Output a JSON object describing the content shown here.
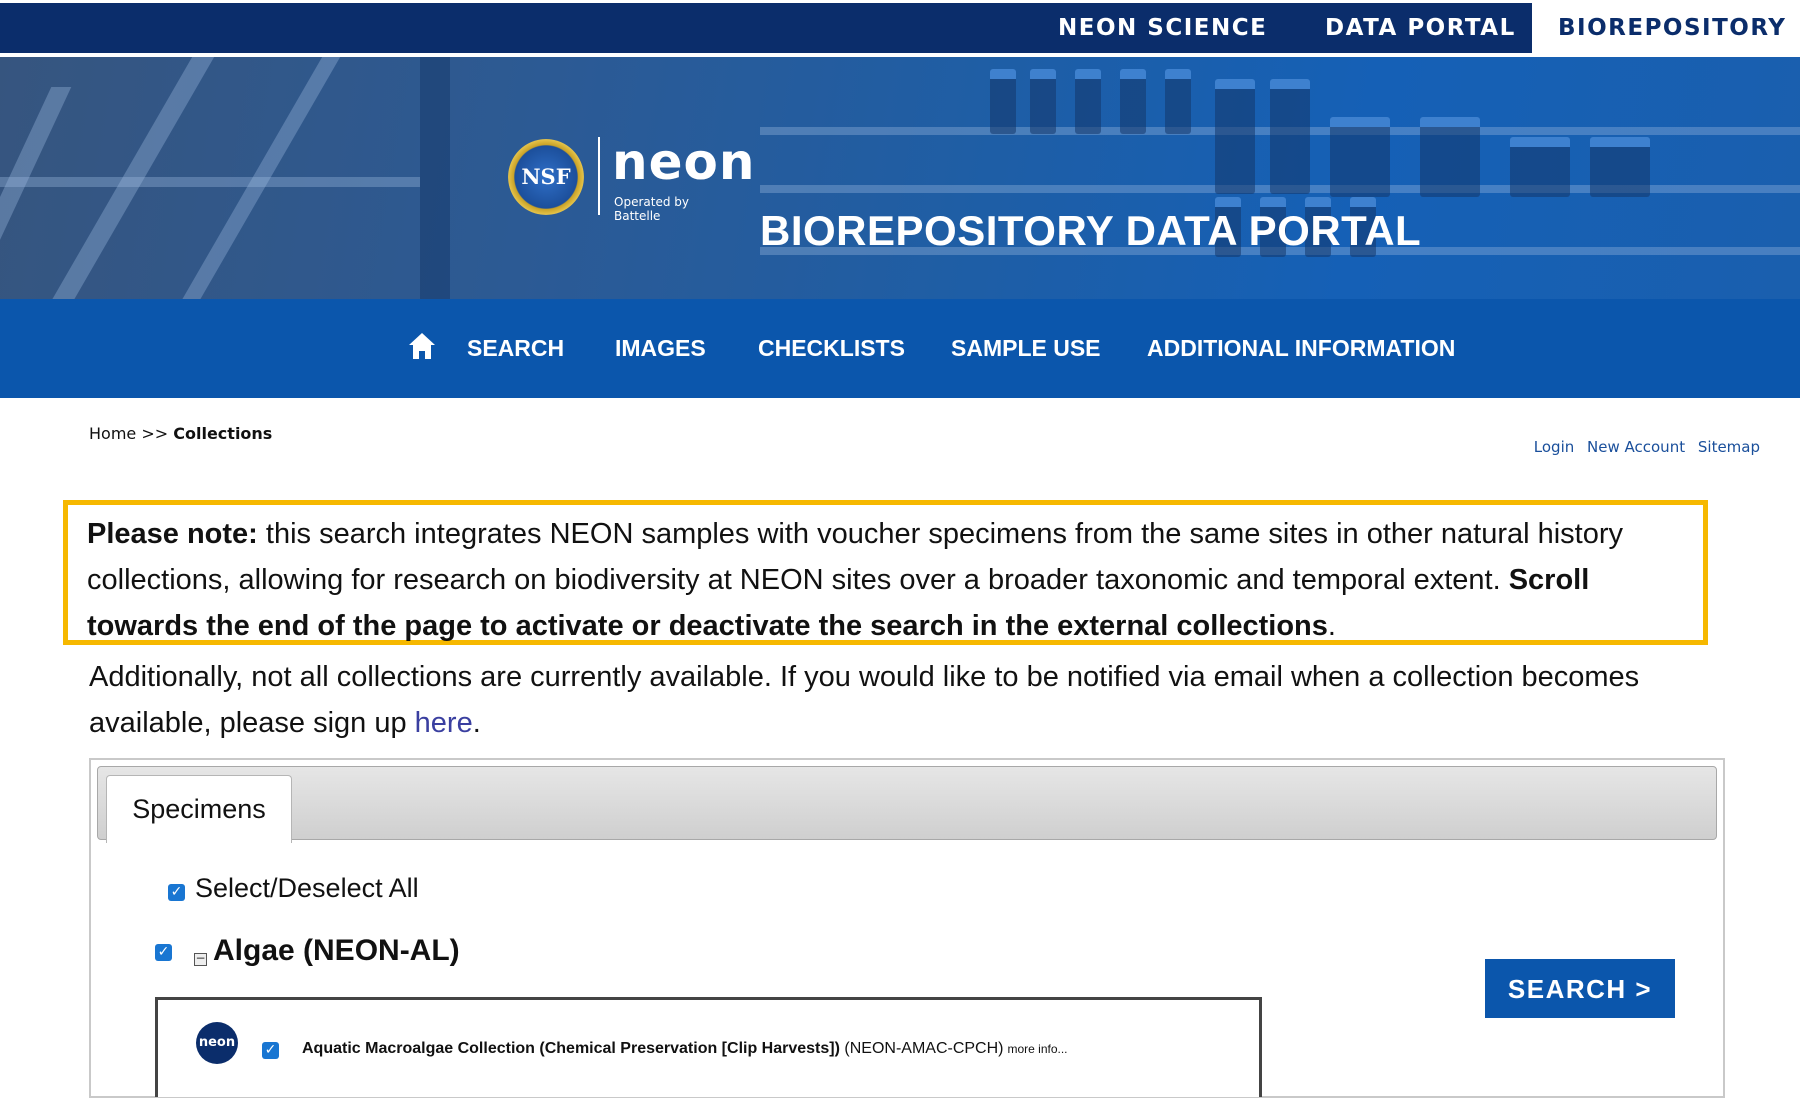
{
  "topbar": {
    "links": [
      {
        "label": "NEON SCIENCE"
      },
      {
        "label": "DATA PORTAL"
      },
      {
        "label": "BIOREPOSITORY",
        "active": true
      }
    ]
  },
  "hero": {
    "nsf_seal_text": "NSF",
    "neon_logo_text": "neon",
    "neon_logo_subtext": "Operated by Battelle",
    "title": "BIOREPOSITORY DATA PORTAL"
  },
  "mainnav": {
    "home_icon": "home-icon",
    "items": [
      {
        "label": "SEARCH"
      },
      {
        "label": "IMAGES"
      },
      {
        "label": "CHECKLISTS"
      },
      {
        "label": "SAMPLE USE"
      },
      {
        "label": "ADDITIONAL INFORMATION"
      }
    ]
  },
  "breadcrumb": {
    "home": "Home",
    "separator": ">>",
    "current": "Collections"
  },
  "utility_links": [
    {
      "label": "Login"
    },
    {
      "label": "New Account"
    },
    {
      "label": "Sitemap"
    }
  ],
  "note": {
    "lead": "Please note:",
    "body": " this search integrates NEON samples with voucher specimens from the same sites in other natural history collections, allowing for research on biodiversity at NEON sites over a broader taxonomic and temporal extent. ",
    "emphasis": "Scroll towards the end of the page to activate or deactivate the search in the external collections",
    "end": "."
  },
  "additional": {
    "text": "Additionally, not all collections are currently available. If you would like to be notified via email when a collection becomes available, please sign up ",
    "link": "here",
    "end": "."
  },
  "tabs": [
    {
      "label": "Specimens",
      "selected": true
    }
  ],
  "select_all": {
    "label": "Select/Deselect All",
    "checked": true
  },
  "group": {
    "label": "Algae (NEON-AL)",
    "checked": true,
    "collapse_symbol": "−"
  },
  "search_button": {
    "label": "SEARCH >"
  },
  "collection": {
    "logo_text": "neon",
    "name": "Aquatic Macroalgae Collection (Chemical Preservation [Clip Harvests])",
    "code": " (NEON-AMAC-CPCH)",
    "more": "more info...",
    "checked": true
  },
  "colors": {
    "topbar": "#0b2d6b",
    "nav": "#0b56ac",
    "highlight_border": "#f6b800",
    "link": "#3a3fa0",
    "checkbox": "#1976d2"
  }
}
